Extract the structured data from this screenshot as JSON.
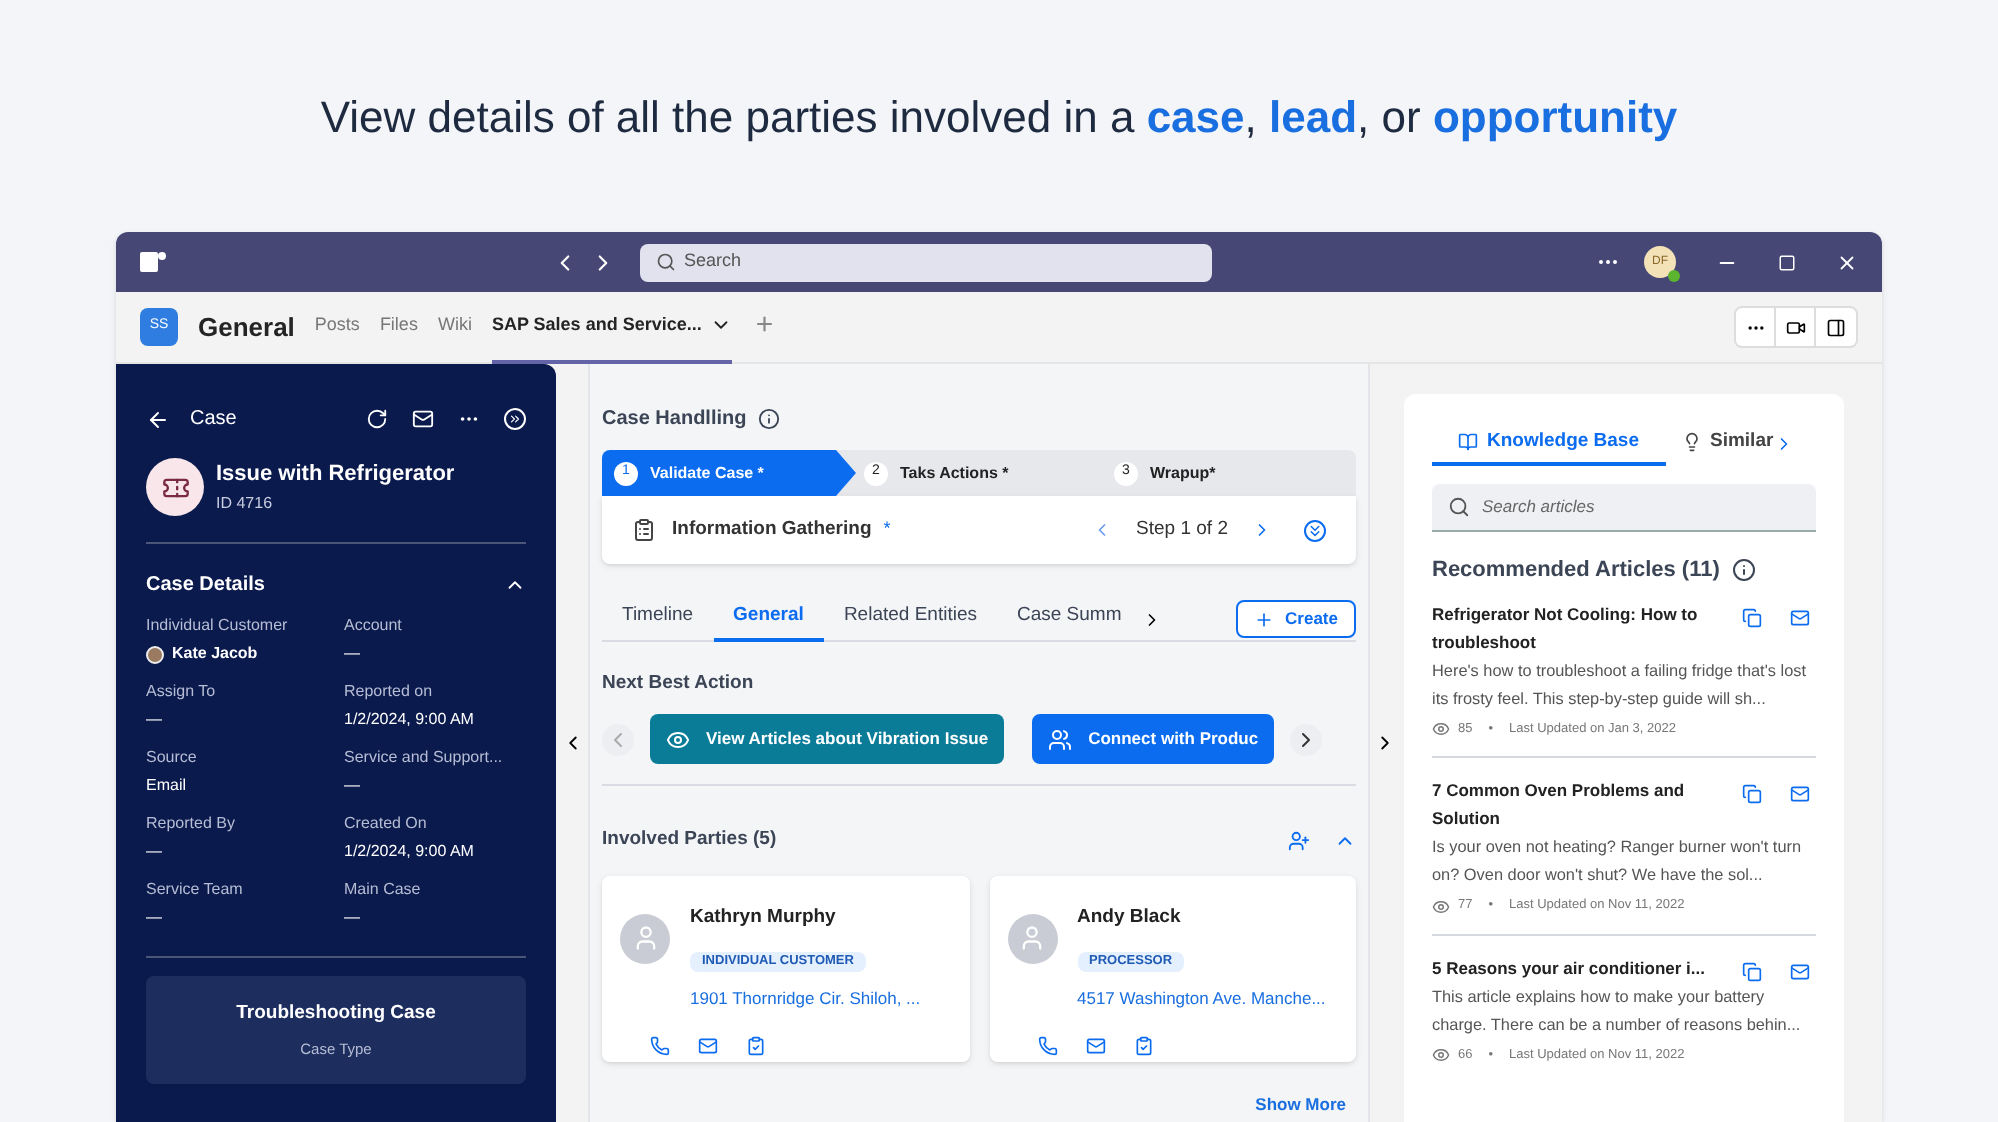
{
  "headline": "View details of all the parties involved in a **case**, **lead**, or **opportunity**",
  "titlebar": {
    "search_placeholder": "Search",
    "avatar_initials": "DF"
  },
  "channel": {
    "badge": "SS",
    "name": "General",
    "tabs": [
      {
        "label": "Posts",
        "selected": false
      },
      {
        "label": "Files",
        "selected": false
      },
      {
        "label": "Wiki",
        "selected": false
      },
      {
        "label": "SAP Sales and Service...",
        "selected": true
      }
    ],
    "add": "+"
  },
  "case": {
    "back_label": "Case",
    "title": "Issue with Refrigerator",
    "id": "ID 4716",
    "details_title": "Case Details",
    "fields": [
      {
        "label": "Individual Customer",
        "value": "Kate Jacob",
        "kind": "person"
      },
      {
        "label": "Account",
        "value": "—",
        "kind": "text"
      },
      {
        "label": "Assign To",
        "value": "—",
        "kind": "text"
      },
      {
        "label": "Reported on",
        "value": "1/2/2024, 9:00 AM",
        "kind": "text"
      },
      {
        "label": "Source",
        "value": "Email",
        "kind": "text"
      },
      {
        "label": "Service and Support...",
        "value": "—",
        "kind": "text"
      },
      {
        "label": "Reported By",
        "value": "—",
        "kind": "text"
      },
      {
        "label": "Created On",
        "value": "1/2/2024, 9:00 AM",
        "kind": "text"
      },
      {
        "label": "Service Team",
        "value": "—",
        "kind": "text"
      },
      {
        "label": "Main Case",
        "value": "—",
        "kind": "text"
      }
    ],
    "type_card": {
      "value": "Troubleshooting Case",
      "label": "Case Type"
    }
  },
  "handling": {
    "title": "Case Handlling",
    "steps": [
      {
        "number": "1",
        "label": "Validate Case *",
        "selected": true
      },
      {
        "number": "2",
        "label": "Taks Actions *",
        "selected": false
      },
      {
        "number": "3",
        "label": "Wrapup*",
        "selected": false
      }
    ],
    "substep": {
      "label": "Information Gathering",
      "required": "*",
      "progress": "Step 1 of 2"
    }
  },
  "tabs": [
    {
      "label": "Timeline",
      "selected": false
    },
    {
      "label": "General",
      "selected": true
    },
    {
      "label": "Related Entities",
      "selected": false
    },
    {
      "label": "Case Summ",
      "selected": false
    }
  ],
  "create_button": "Create",
  "next_best_action": {
    "title": "Next Best Action",
    "actions": [
      {
        "label": "View Articles about Vibration Issue",
        "color": "#0a7c98",
        "kind": "eye"
      },
      {
        "label": "Connect with Produc",
        "color": "#0b6cf0",
        "kind": "people"
      }
    ]
  },
  "involved_parties": {
    "title": "Involved Parties (5)",
    "parties": [
      {
        "name": "Kathryn Murphy",
        "role": "INDIVIDUAL CUSTOMER",
        "address": "1901 Thornridge Cir. Shiloh, ..."
      },
      {
        "name": "Andy Black",
        "role": "PROCESSOR",
        "address": "4517 Washington Ave. Manche..."
      }
    ],
    "show_more": "Show More"
  },
  "knowledge": {
    "tabs": [
      {
        "label": "Knowledge Base",
        "selected": true
      },
      {
        "label": "Similar",
        "selected": false
      }
    ],
    "search_placeholder": "Search articles",
    "title": "Recommended Articles (11)",
    "separator": "•",
    "articles": [
      {
        "title": "Refrigerator Not Cooling: How to troubleshoot",
        "excerpt": "Here's how to troubleshoot a failing fridge that's lost its frosty feel. This step-by-step guide will sh...",
        "views": "85",
        "updated": "Last Updated on Jan 3, 2022"
      },
      {
        "title": "7 Common Oven Problems and Solution",
        "excerpt": "Is your oven not heating? Ranger burner won't turn on? Oven door won't shut? We have the sol...",
        "views": "77",
        "updated": "Last Updated on Nov 11, 2022"
      },
      {
        "title": "5 Reasons your air conditioner i...",
        "excerpt": "This article explains how to make your battery charge. There can be a number of reasons behin...",
        "views": "66",
        "updated": "Last Updated on Nov 11, 2022"
      }
    ]
  }
}
